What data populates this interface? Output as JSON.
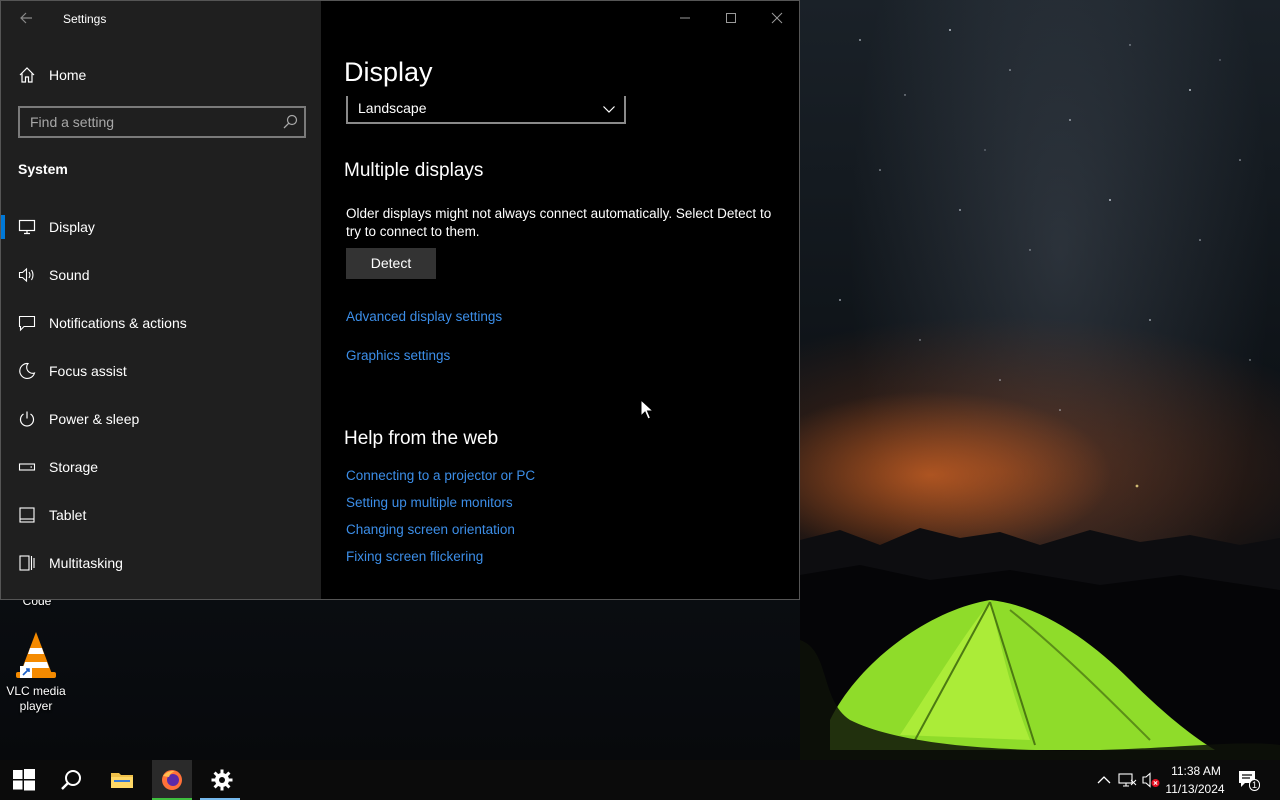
{
  "window": {
    "title": "Settings",
    "back_icon": "back-arrow-icon",
    "controls": [
      "minimize",
      "maximize",
      "close"
    ]
  },
  "nav": {
    "home_label": "Home",
    "search_placeholder": "Find a setting",
    "section_label": "System",
    "items": [
      {
        "label": "Display",
        "icon": "monitor-icon",
        "selected": true
      },
      {
        "label": "Sound",
        "icon": "speaker-icon",
        "selected": false
      },
      {
        "label": "Notifications & actions",
        "icon": "notification-icon",
        "selected": false
      },
      {
        "label": "Focus assist",
        "icon": "moon-icon",
        "selected": false
      },
      {
        "label": "Power & sleep",
        "icon": "power-icon",
        "selected": false
      },
      {
        "label": "Storage",
        "icon": "storage-icon",
        "selected": false
      },
      {
        "label": "Tablet",
        "icon": "tablet-icon",
        "selected": false
      },
      {
        "label": "Multitasking",
        "icon": "multitasking-icon",
        "selected": false
      }
    ]
  },
  "main": {
    "page_title": "Display",
    "orientation_value": "Landscape",
    "multiple_displays": {
      "heading": "Multiple displays",
      "description": "Older displays might not always connect automatically. Select Detect to try to connect to them.",
      "detect_label": "Detect"
    },
    "links": {
      "advanced": "Advanced display settings",
      "graphics": "Graphics settings"
    },
    "help": {
      "heading": "Help from the web",
      "links": [
        "Connecting to a projector or PC",
        "Setting up multiple monitors",
        "Changing screen orientation",
        "Fixing screen flickering"
      ]
    }
  },
  "desktop": {
    "icons": [
      {
        "label": "Code"
      },
      {
        "label": "VLC media player"
      }
    ]
  },
  "taskbar": {
    "apps": [
      "start",
      "search",
      "file-explorer",
      "firefox",
      "settings"
    ],
    "clock_time": "11:38 AM",
    "clock_date": "11/13/2024",
    "notification_count": "1"
  },
  "colors": {
    "accent": "#0078d7",
    "link": "#3c8ee8",
    "nav_bg": "#1f1f1f",
    "content_bg": "#000000"
  }
}
